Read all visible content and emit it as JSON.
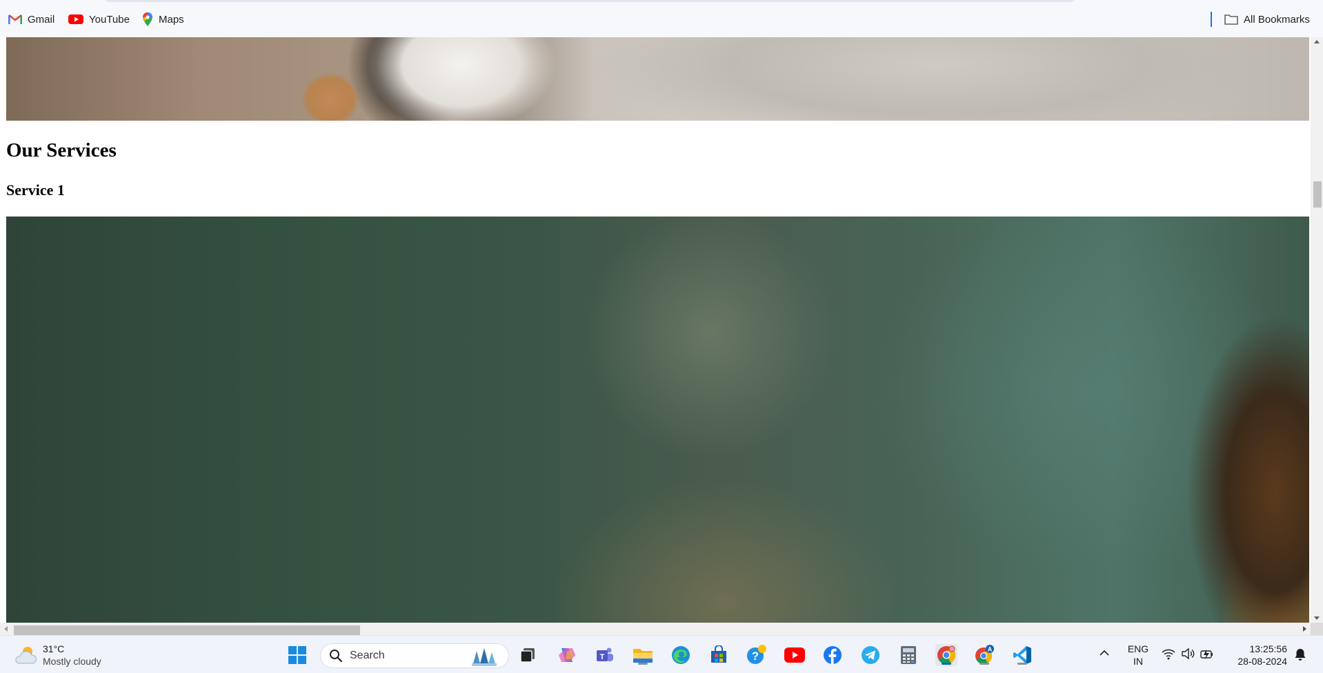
{
  "bookmarks": {
    "items": [
      {
        "label": "Gmail",
        "icon": "gmail-icon"
      },
      {
        "label": "YouTube",
        "icon": "youtube-icon"
      },
      {
        "label": "Maps",
        "icon": "maps-icon"
      }
    ],
    "all_bookmarks": "All Bookmarks"
  },
  "page": {
    "section_title": "Our Services",
    "service_title": "Service 1"
  },
  "taskbar": {
    "weather": {
      "temp": "31°C",
      "desc": "Mostly cloudy",
      "icon": "partly-cloudy-icon"
    },
    "search_label": "Search",
    "apps": [
      "windows-start",
      "search",
      "task-view",
      "copilot",
      "teams",
      "file-explorer",
      "edge",
      "microsoft-store",
      "get-help",
      "youtube",
      "facebook",
      "telegram",
      "calculator",
      "chrome",
      "chrome-profile",
      "vscode"
    ],
    "language": {
      "line1": "ENG",
      "line2": "IN"
    },
    "clock": {
      "time": "13:25:56",
      "date": "28-08-2024"
    }
  },
  "colors": {
    "accent": "#0067c0",
    "bookmark_bar_bg": "#f6f8fc",
    "taskbar_bg": "#f0f3f9"
  }
}
